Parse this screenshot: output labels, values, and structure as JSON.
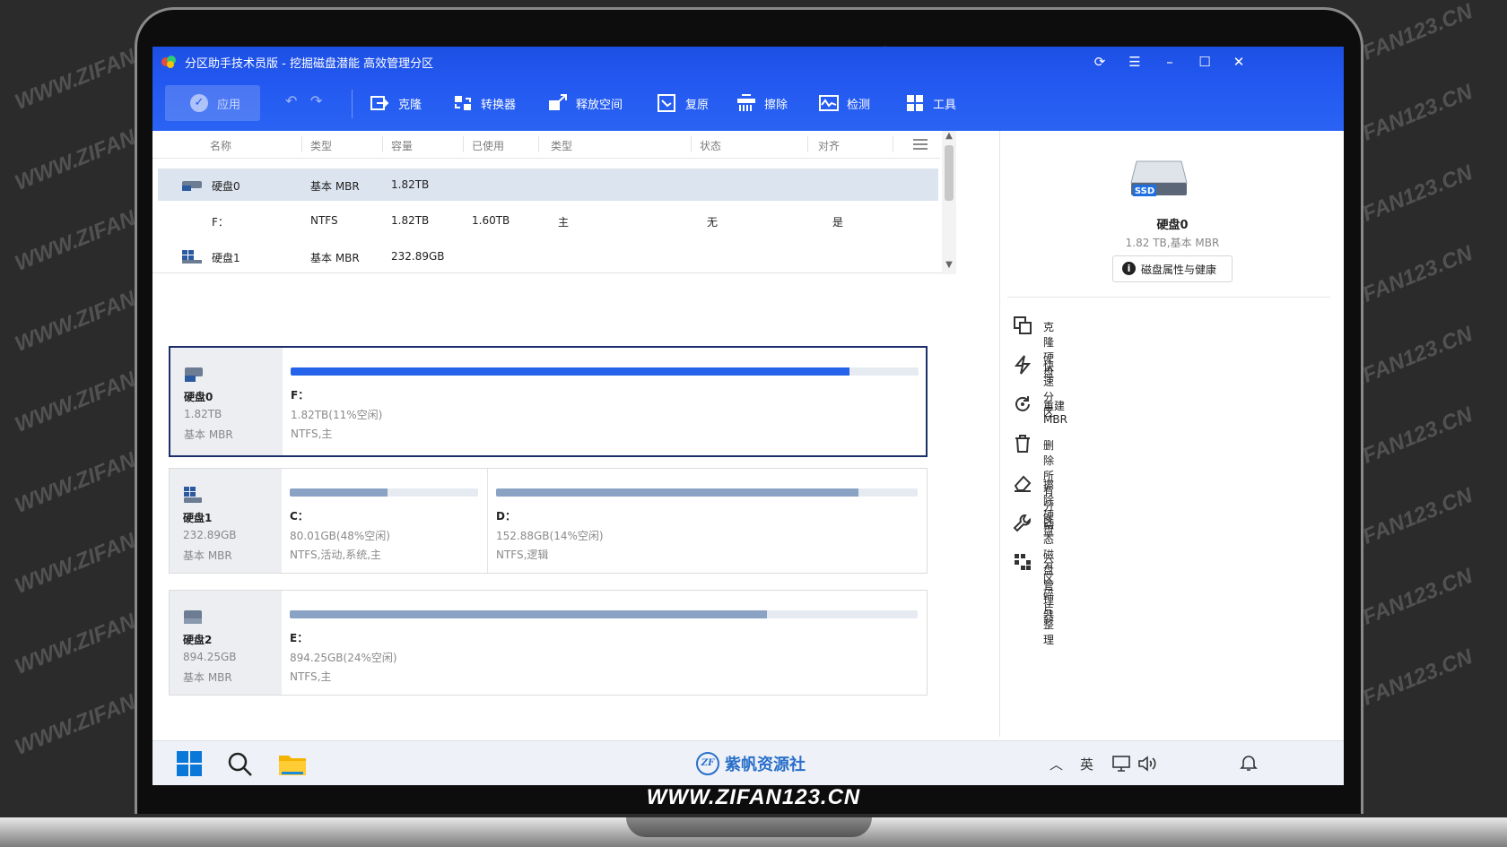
{
  "watermark": {
    "text": "WWW.ZIFAN123.CN"
  },
  "site_banner": "WWW.ZIFAN123.CN",
  "app": {
    "title": "分区助手技术员版 - 挖掘磁盘潜能 高效管理分区",
    "window_buttons": [
      "refresh-icon",
      "menu-icon",
      "minimize-icon",
      "maximize-icon",
      "close-icon"
    ]
  },
  "toolbar": {
    "apply_label": "应用",
    "tools": [
      {
        "label": "克隆",
        "icon": "clone-icon"
      },
      {
        "label": "转换器",
        "icon": "converter-icon"
      },
      {
        "label": "释放空间",
        "icon": "free-space-icon"
      },
      {
        "label": "复原",
        "icon": "restore-icon"
      },
      {
        "label": "擦除",
        "icon": "wipe-icon"
      },
      {
        "label": "检测",
        "icon": "detect-icon"
      },
      {
        "label": "工具",
        "icon": "tools-icon"
      }
    ]
  },
  "list": {
    "columns": [
      "名称",
      "类型",
      "容量",
      "已使用",
      "类型",
      "状态",
      "对齐"
    ],
    "rows": [
      {
        "name": "硬盘0",
        "type": "基本 MBR",
        "capacity": "1.82TB",
        "used": "",
        "ptype": "",
        "status": "",
        "align": "",
        "is_disk": true,
        "selected": true
      },
      {
        "name": "F：",
        "type": "NTFS",
        "capacity": "1.82TB",
        "used": "1.60TB",
        "ptype": "主",
        "status": "无",
        "align": "是",
        "is_disk": false,
        "selected": false
      },
      {
        "name": "硬盘1",
        "type": "基本 MBR",
        "capacity": "232.89GB",
        "used": "",
        "ptype": "",
        "status": "",
        "align": "",
        "is_disk": true,
        "selected": false
      }
    ]
  },
  "disks": [
    {
      "name": "硬盘0",
      "size": "1.82TB",
      "type": "基本 MBR",
      "icon": "ssd-disk-icon",
      "partitions": [
        {
          "label": "F：",
          "info": "1.82TB(11%空闲)",
          "fs": "NTFS,主",
          "used_fraction": 0.89,
          "color": "#2563eb"
        }
      ]
    },
    {
      "name": "硬盘1",
      "size": "232.89GB",
      "type": "基本 MBR",
      "icon": "windows-disk-icon",
      "partitions": [
        {
          "label": "C：",
          "info": "80.01GB(48%空闲)",
          "fs": "NTFS,活动,系统,主",
          "used_fraction": 0.52,
          "color": "#8aa2c4"
        },
        {
          "label": "D：",
          "info": "152.88GB(14%空闲)",
          "fs": "NTFS,逻辑",
          "used_fraction": 0.86,
          "color": "#8aa2c4"
        }
      ]
    },
    {
      "name": "硬盘2",
      "size": "894.25GB",
      "type": "基本 MBR",
      "icon": "disk-icon",
      "partitions": [
        {
          "label": "E：",
          "info": "894.25GB(24%空闲)",
          "fs": "NTFS,主",
          "used_fraction": 0.76,
          "color": "#8aa2c4"
        }
      ]
    }
  ],
  "right_panel": {
    "disk_name": "硬盘0",
    "disk_info": "1.82 TB,基本 MBR",
    "ssd_badge": "SSD",
    "health_button": "磁盘属性与健康",
    "actions": [
      {
        "label": "克隆硬盘",
        "icon": "clone-disk-icon"
      },
      {
        "label": "快速分区",
        "icon": "lightning-icon"
      },
      {
        "label": "重建MBR",
        "icon": "rebuild-icon"
      },
      {
        "label": "删除所有分区",
        "icon": "trash-icon"
      },
      {
        "label": "擦除硬盘",
        "icon": "eraser-icon"
      },
      {
        "label": "动态磁盘管理器",
        "icon": "wrench-icon"
      },
      {
        "label": "分区碎片整理",
        "icon": "defrag-icon"
      }
    ]
  },
  "taskbar": {
    "brand_logo": "ZF",
    "brand_text": "紫帆资源社",
    "ime": "英"
  },
  "colors": {
    "accent": "#2257ef",
    "selected_row": "#dce4ef",
    "active_border": "#1c2f6b"
  }
}
